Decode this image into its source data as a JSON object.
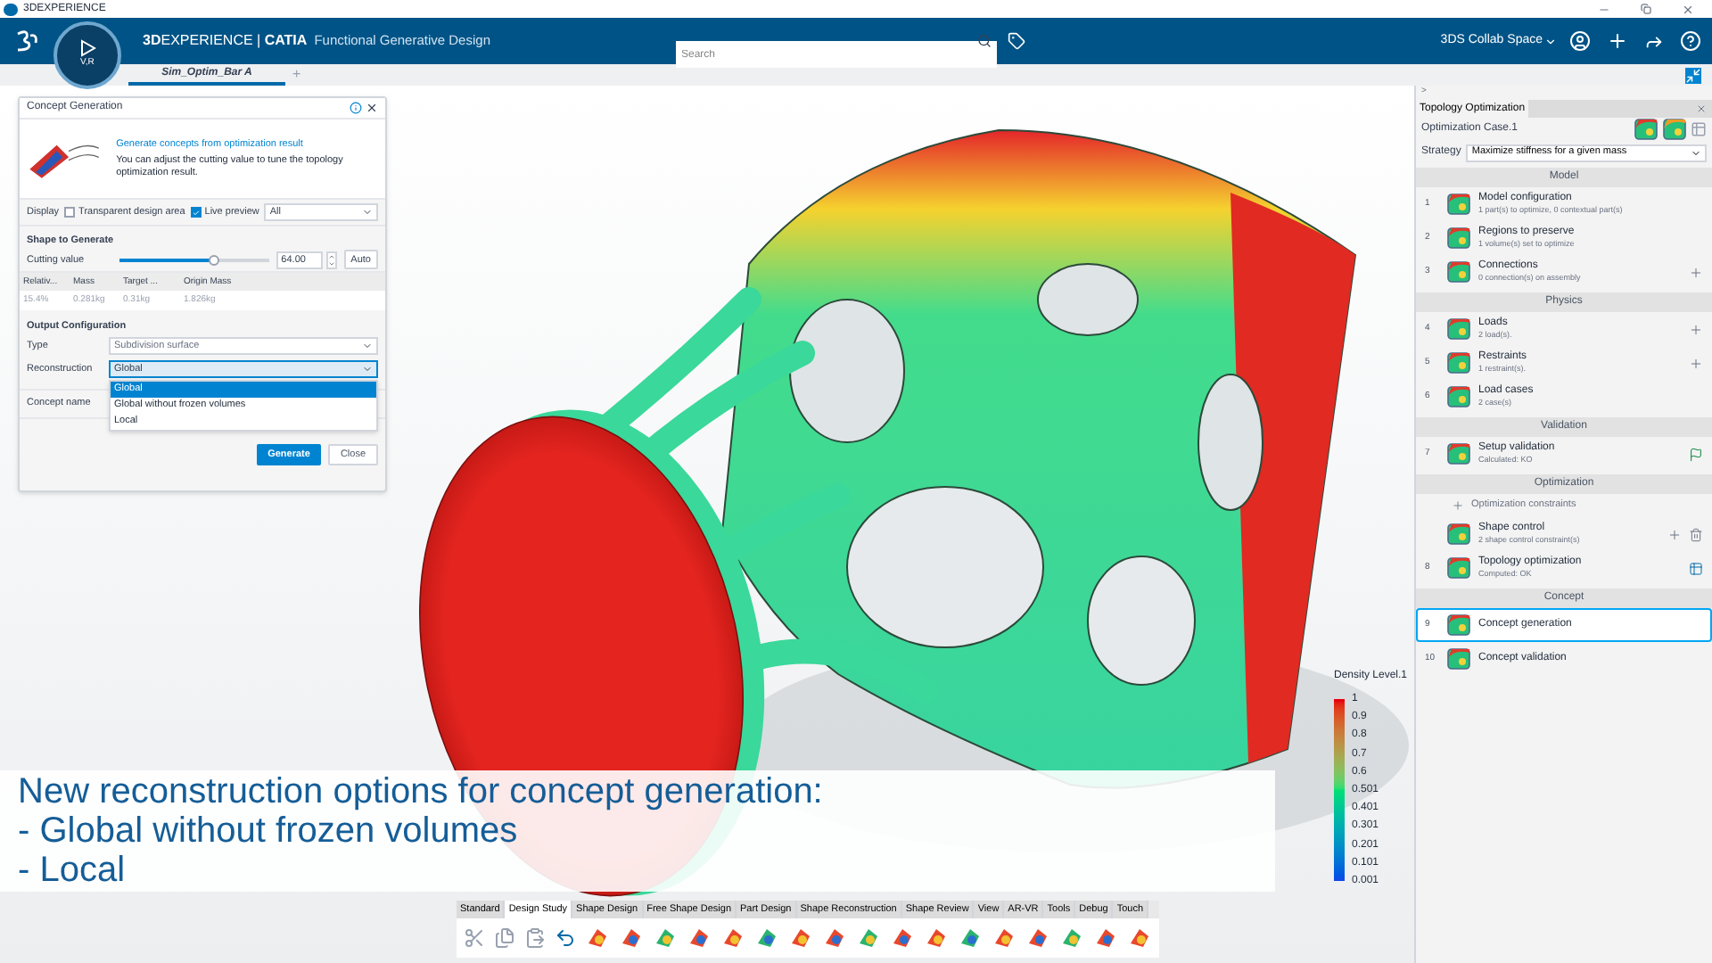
{
  "window": {
    "title": "3DEXPERIENCE"
  },
  "header": {
    "brand": "**3D**EXPERIENCE | **CATIA**",
    "app_name": "Functional Generative Design",
    "compass_label": "V,R",
    "search": {
      "placeholder": "Search"
    },
    "collab_space": "3DS Collab Space"
  },
  "tabs": [
    {
      "label": "Sim_Optim_Bar A",
      "selected": true
    }
  ],
  "new_tab": "+",
  "dialog": {
    "title": "Concept Generation",
    "link": "Generate concepts from optimization result",
    "description": "You can adjust the cutting value to tune the topology optimization result.",
    "display": {
      "label": "Display",
      "options": [
        {
          "label": "Transparent design area",
          "checked": false
        },
        {
          "label": "Live preview",
          "checked": true
        }
      ],
      "filter": "All"
    },
    "shape_section": "Shape to Generate",
    "cutting": {
      "label": "Cutting value",
      "level": 0.63,
      "value": "64.00",
      "auto": "Auto"
    },
    "table": {
      "columns": [
        "Relativ...",
        "Mass",
        "Target ...",
        "Origin Mass"
      ],
      "rows": [
        [
          "15.4%",
          "0.281kg",
          "0.31kg",
          "1.826kg"
        ]
      ]
    },
    "output_section": "Output Configuration",
    "type": {
      "label": "Type",
      "value": "Subdivision surface"
    },
    "reconstruction": {
      "label": "Reconstruction",
      "value": "Global",
      "expanded": true,
      "options": [
        {
          "label": "Global",
          "selected": true
        },
        {
          "label": "Global without frozen volumes",
          "selected": false
        },
        {
          "label": "Local",
          "selected": false
        }
      ]
    },
    "concept_name": {
      "label": "Concept name"
    },
    "buttons": [
      {
        "label": "Generate",
        "primary": true
      },
      {
        "label": "Close",
        "primary": false
      }
    ]
  },
  "panel": {
    "expand": ">",
    "title": "Topology Optimization",
    "case": "Optimization Case.1",
    "strategy": {
      "label": "Strategy",
      "value": "Maximize stiffness for a given mass"
    },
    "sections": [
      {
        "title": "Model",
        "items": [
          {
            "kind": "step",
            "number": "1",
            "title": "Model configuration",
            "subtitle": "1 part(s) to optimize, 0 contextual part(s)",
            "selected": false
          },
          {
            "kind": "step",
            "number": "2",
            "title": "Regions to preserve",
            "subtitle": "1 volume(s) set to optimize",
            "selected": false
          },
          {
            "kind": "step",
            "number": "3",
            "title": "Connections",
            "subtitle": "0 connection(s) on assembly",
            "tools": [
              {
                "kind": "add"
              }
            ],
            "selected": false
          }
        ]
      },
      {
        "title": "Physics",
        "items": [
          {
            "kind": "step",
            "number": "4",
            "title": "Loads",
            "subtitle": "2 load(s).",
            "tools": [
              {
                "kind": "add"
              }
            ],
            "selected": false
          },
          {
            "kind": "step",
            "number": "5",
            "title": "Restraints",
            "subtitle": "1 restraint(s).",
            "tools": [
              {
                "kind": "add"
              }
            ],
            "selected": false
          },
          {
            "kind": "step",
            "number": "6",
            "title": "Load cases",
            "subtitle": "2 case(s)",
            "selected": false
          }
        ]
      },
      {
        "title": "Validation",
        "items": [
          {
            "kind": "step",
            "number": "7",
            "title": "Setup validation",
            "subtitle": "Calculated: KO",
            "tools": [
              {
                "kind": "run"
              }
            ],
            "selected": false
          }
        ]
      },
      {
        "title": "Optimization",
        "items": [
          {
            "kind": "link",
            "title": "Optimization constraints"
          },
          {
            "kind": "step",
            "title": "Shape control",
            "subtitle": "2 shape control constraint(s)",
            "tools": [
              {
                "kind": "add"
              },
              {
                "kind": "delete"
              }
            ],
            "selected": false
          },
          {
            "kind": "step",
            "number": "8",
            "title": "Topology optimization",
            "subtitle": "Computed: OK",
            "tools": [
              {
                "kind": "results"
              }
            ],
            "selected": false
          }
        ]
      },
      {
        "title": "Concept",
        "items": [
          {
            "kind": "step",
            "number": "9",
            "title": "Concept generation",
            "selected": true
          },
          {
            "kind": "step",
            "number": "10",
            "title": "Concept validation",
            "selected": false
          }
        ]
      }
    ]
  },
  "legend": {
    "title": "Density Level.1",
    "ticks": [
      "1",
      "0.9",
      "0.8",
      "0.7",
      "0.6",
      "0.501",
      "0.401",
      "0.301",
      "0.201",
      "0.101",
      "0.001"
    ]
  },
  "caption": {
    "heading": "New reconstruction options for concept generation:",
    "lines": [
      "- Global without frozen volumes",
      "- Local"
    ]
  },
  "toolbar": {
    "tabs": [
      {
        "label": "Standard",
        "selected": false
      },
      {
        "label": "Design Study",
        "selected": true
      },
      {
        "label": "Shape Design",
        "selected": false
      },
      {
        "label": "Free Shape Design",
        "selected": false
      },
      {
        "label": "Part Design",
        "selected": false
      },
      {
        "label": "Shape Reconstruction",
        "selected": false
      },
      {
        "label": "Shape Review",
        "selected": false
      },
      {
        "label": "View",
        "selected": false
      },
      {
        "label": "AR-VR",
        "selected": false
      },
      {
        "label": "Tools",
        "selected": false
      },
      {
        "label": "Debug",
        "selected": false
      },
      {
        "label": "Touch",
        "selected": false
      }
    ]
  }
}
